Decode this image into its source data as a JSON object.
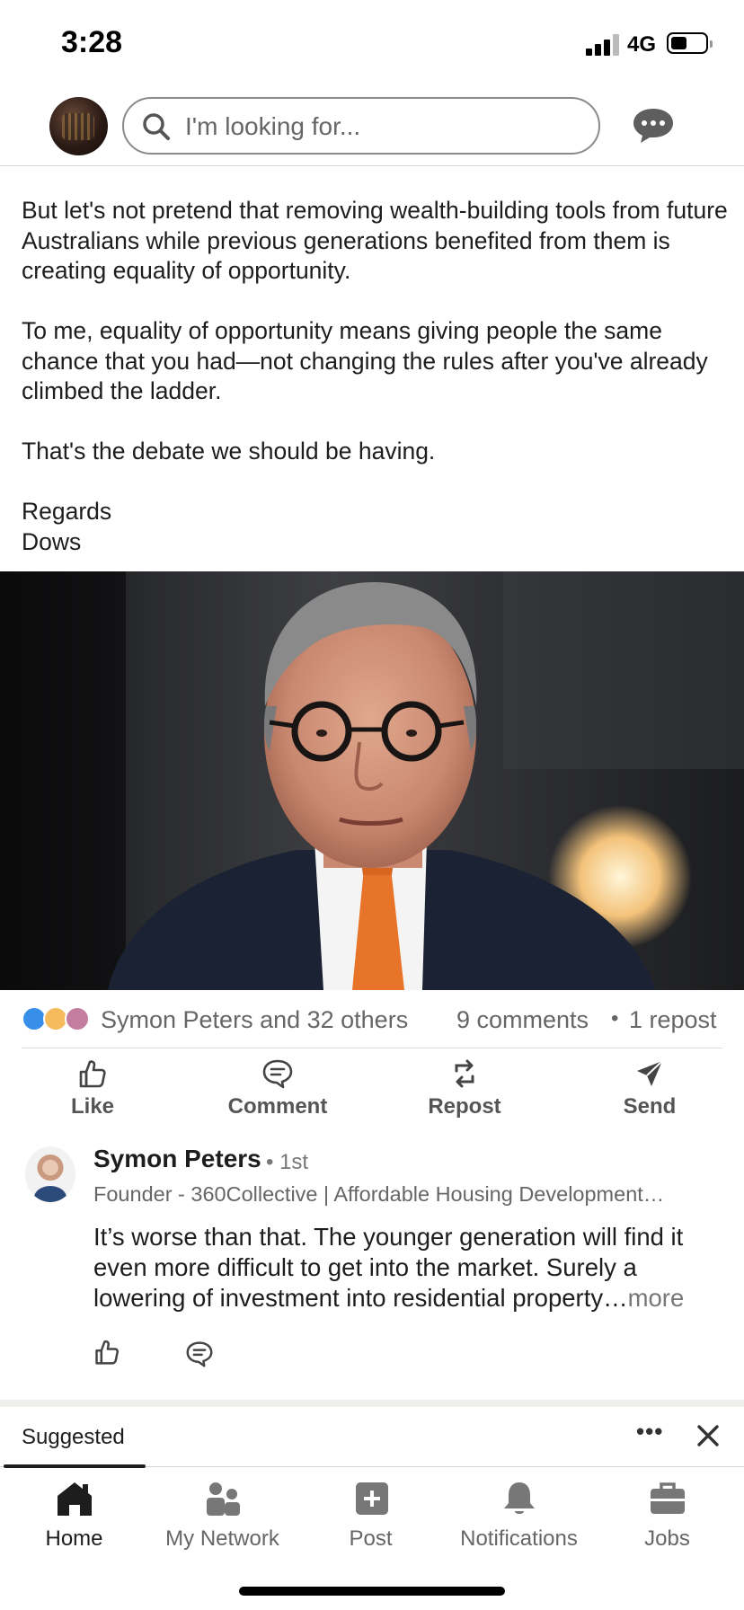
{
  "status_bar": {
    "time": "3:28",
    "network": "4G"
  },
  "top_bar": {
    "search_placeholder": "I'm looking for..."
  },
  "post": {
    "paragraphs": [
      "But let's not pretend that removing wealth-building tools from future Australians while previous generations benefited from them is creating equality of opportunity.",
      "To me, equality of opportunity means giving people the same chance that you had—not changing the rules after you've already climbed the ladder.",
      "That's the debate we should be having."
    ],
    "signoff": "Regards",
    "signature": "Dows"
  },
  "social": {
    "reactions_text": "Symon Peters and 32 others",
    "comments_text": "9 comments",
    "separator": "•",
    "reposts_text": "1 repost",
    "reaction_colors": [
      "#378fe9",
      "#f5bb5c",
      "#c37d9f"
    ]
  },
  "actions": {
    "like": "Like",
    "comment": "Comment",
    "repost": "Repost",
    "send": "Send"
  },
  "comment": {
    "author": "Symon Peters",
    "degree": "• 1st",
    "headline": "Founder - 360Collective | Affordable Housing Development…",
    "text": "It’s worse than that. The younger generation will find it even more difficult to get into the market. Surely a lowering of investment into residential property…",
    "more_label": "more"
  },
  "suggested": {
    "label": "Suggested",
    "more": "•••"
  },
  "nav": {
    "home": "Home",
    "network": "My Network",
    "post": "Post",
    "notifications": "Notifications",
    "jobs": "Jobs"
  }
}
